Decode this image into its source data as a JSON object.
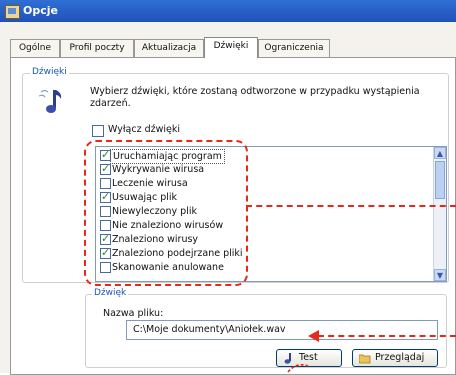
{
  "window": {
    "title": "Opcje"
  },
  "tabs": [
    {
      "label": "Ogólne"
    },
    {
      "label": "Profil poczty"
    },
    {
      "label": "Aktualizacja"
    },
    {
      "label": "Dźwięki"
    },
    {
      "label": "Ograniczenia"
    }
  ],
  "sounds": {
    "group_label": "Dźwięki",
    "icon": "music-note-icon",
    "description": "Wybierz dźwięki, które zostaną odtworzone w przypadku wystąpienia zdarzeń.",
    "disable_label": "Wyłącz dźwięki",
    "disable_checked": false,
    "events": [
      {
        "label": "Uruchamiając program",
        "checked": true,
        "selected": true
      },
      {
        "label": "Wykrywanie wirusa",
        "checked": true
      },
      {
        "label": "Leczenie wirusa",
        "checked": false
      },
      {
        "label": "Usuwając plik",
        "checked": true
      },
      {
        "label": "Niewyleczony plik",
        "checked": false
      },
      {
        "label": "Nie znaleziono wirusów",
        "checked": false
      },
      {
        "label": "Znaleziono wirusy",
        "checked": true
      },
      {
        "label": "Znaleziono podejrzane pliki",
        "checked": true
      },
      {
        "label": "Skanowanie anulowane",
        "checked": false
      }
    ]
  },
  "sound_file": {
    "group_label": "Dźwięk",
    "field_label": "Nazwa pliku:",
    "value": "C:\\Moje dokumenty\\Aniołek.wav",
    "test_label": "Test",
    "browse_label": "Przeglądaj"
  },
  "colors": {
    "annotation": "#e52a1a",
    "accent": "#1b56b8",
    "titlebar": "#2f6fd6"
  }
}
